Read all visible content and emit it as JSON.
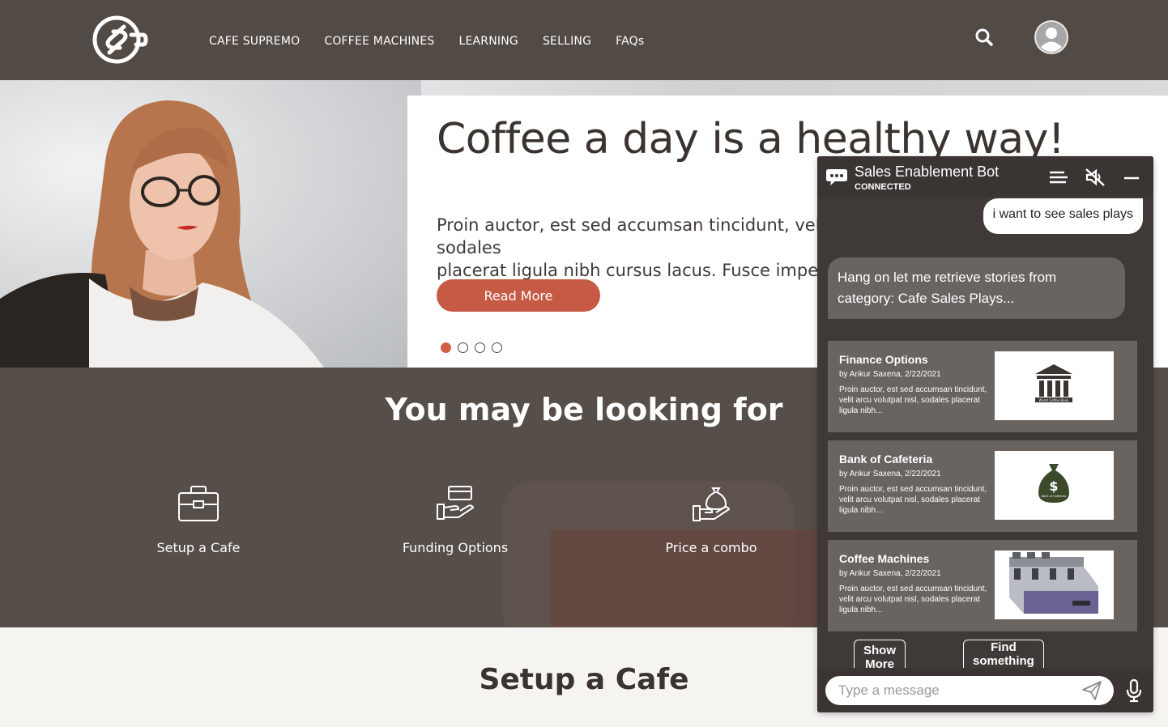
{
  "header": {
    "logo_icon": "cafe-s-logo",
    "nav": [
      "CAFE SUPREMO",
      "COFFEE MACHINES",
      "LEARNING",
      "SELLING",
      "FAQs"
    ],
    "search_icon": "search-icon",
    "avatar_icon": "user-avatar-icon"
  },
  "hero": {
    "title": "Coffee a day is a healthy way!",
    "body": "Proin auctor, est sed accumsan tincidunt, velit arcu volutpat nisl, sodales\nplacerat ligula nibh cursus lacus. Fusce imperdiet",
    "button": "Read More",
    "slides": 4,
    "active_slide": 1
  },
  "looking": {
    "title": "You may be looking for",
    "features": [
      {
        "label": "Setup a Cafe",
        "icon": "briefcase-icon"
      },
      {
        "label": "Funding Options",
        "icon": "card-in-hand-icon"
      },
      {
        "label": "Price a combo",
        "icon": "money-bag-hand-icon"
      }
    ]
  },
  "setup": {
    "title": "Setup a Cafe"
  },
  "chat": {
    "title": "Sales Enablement Bot",
    "status": "CONNECTED",
    "user_message": "i want to see sales plays",
    "bot_message": "Hang on let me retrieve stories from category: Cafe Sales Plays...",
    "cards": [
      {
        "title": "Finance Options",
        "meta": "by Ankur Saxena, 2/22/2021",
        "desc": "Proin auctor, est sed accumsan tincidunt, velit arcu volutpat nisl, sodales placerat ligula nibh...",
        "image_icon": "bank-building-icon",
        "image_caption": "World Coffee Bank"
      },
      {
        "title": "Bank of Cafeteria",
        "meta": "by Ankur Saxena, 2/22/2021",
        "desc": "Proin auctor, est sed accumsan tincidunt, velit arcu volutpat nisl, sodales placerat ligula nibh...",
        "image_icon": "money-bag-icon",
        "image_caption": "Bank of Cafeteria"
      },
      {
        "title": "Coffee Machines",
        "meta": "by Ankur Saxena, 2/22/2021",
        "desc": "Proin auctor, est sed accumsan tincidunt, velit arcu volutpat nisl, sodales placerat ligula nibh...",
        "image_icon": "espresso-machine-icon"
      }
    ],
    "chips": [
      "Show More",
      "Find something else"
    ],
    "input_placeholder": "Type a message",
    "colors": {
      "accent": "#c65a44",
      "panel": "#3f3a37",
      "card": "#6a6461"
    }
  }
}
